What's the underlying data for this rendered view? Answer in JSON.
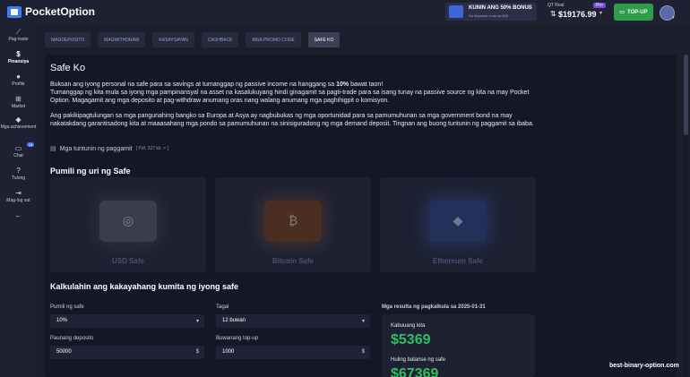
{
  "brand": {
    "name": "PocketOption"
  },
  "promo": {
    "title": "KUNIN ANG 50% BONUS",
    "subtitle": "Sa deposito mula sa $50",
    "close": "×"
  },
  "account": {
    "type": "QT Real",
    "badge": "Pro",
    "balance": "$19176.99",
    "topup_label": "TOP-UP"
  },
  "sidebar": {
    "items": [
      {
        "label": "Pag-trade",
        "icon": "chart-icon",
        "glyph": "📈"
      },
      {
        "label": "Pinansiya",
        "icon": "dollar-icon",
        "glyph": "$"
      },
      {
        "label": "Profile",
        "icon": "user-icon",
        "glyph": "●"
      },
      {
        "label": "Market",
        "icon": "cart-icon",
        "glyph": "🛒"
      },
      {
        "label": "Mga achievement",
        "icon": "diamond-icon",
        "glyph": "◆"
      },
      {
        "label": "Chat",
        "icon": "chat-icon",
        "glyph": "💬",
        "badge": "14"
      },
      {
        "label": "Tulong",
        "icon": "help-icon",
        "glyph": "?"
      },
      {
        "label": "Mag-log out",
        "icon": "logout-icon",
        "glyph": "⇥"
      },
      {
        "label": "",
        "icon": "collapse-icon",
        "glyph": "←"
      }
    ]
  },
  "tabs": [
    "MAGDEPOSITO",
    "MAGWITHDRAW",
    "KASAYSAYAN",
    "CASHBACK",
    "MGA PROMO CODE",
    "SAFE KO"
  ],
  "content": {
    "title": "Safe Ko",
    "para1a": "Buksan ang iyong personal na safe para sa savings at tumanggap ng passive income na hanggang sa ",
    "para1b": "10%",
    "para1c": " bawat taon!",
    "para2": "Tumanggap ng kita mula sa iyong mga pampinansyal na asset na kasalukuyang hindi ginagamit sa pagti-trade para sa isang tunay na passive source ng kita na may Pocket Option. Magagamit ang mga deposito at pag-withdraw anumang oras nang walang anumang mga paghihigpit o komisyon.",
    "para3": "Ang pakikipagtulungan sa mga pangunahing bangko sa Europa at Asya ay nagbubukas ng mga oportunidad para sa pamumuhunan sa mga government bond na may nakatakdang garantisadong kita at maaasahang mga pondo sa pamumuhunan na sinisiguradong ng mga demand deposit. Tingnan ang buong tuntunin ng paggamit sa ibaba.",
    "guide_label": "Mga tuntunin ng paggamit",
    "guide_meta": "[ Pdf, 327 kb ",
    "guide_meta_end": " ]",
    "choose_title": "Pumili ng uri ng Safe",
    "safes": [
      "USD Safe",
      "Bitcoin Safe",
      "Ethereum Safe"
    ],
    "calc_heading": "Kalkulahin ang kakayahang kumita ng iyong safe"
  },
  "form": {
    "safe_label": "Pumili ng safe",
    "safe_value": "10%",
    "term_label": "Tagal",
    "term_value": "12 buwan",
    "deposit_label": "Paunang deposito",
    "deposit_value": "50000",
    "deposit_suffix": "$",
    "topup_label": "Buwanang top-up",
    "topup_value": "1000",
    "topup_suffix": "$"
  },
  "result": {
    "title": "Mga resulta ng pagkalkula sa 2025-01-31",
    "income_label": "Kabuuang kita",
    "income_value": "$5369",
    "final_label": "Huling balanse ng safe",
    "final_value": "$67369"
  },
  "watermark": "best-binary-option.com"
}
